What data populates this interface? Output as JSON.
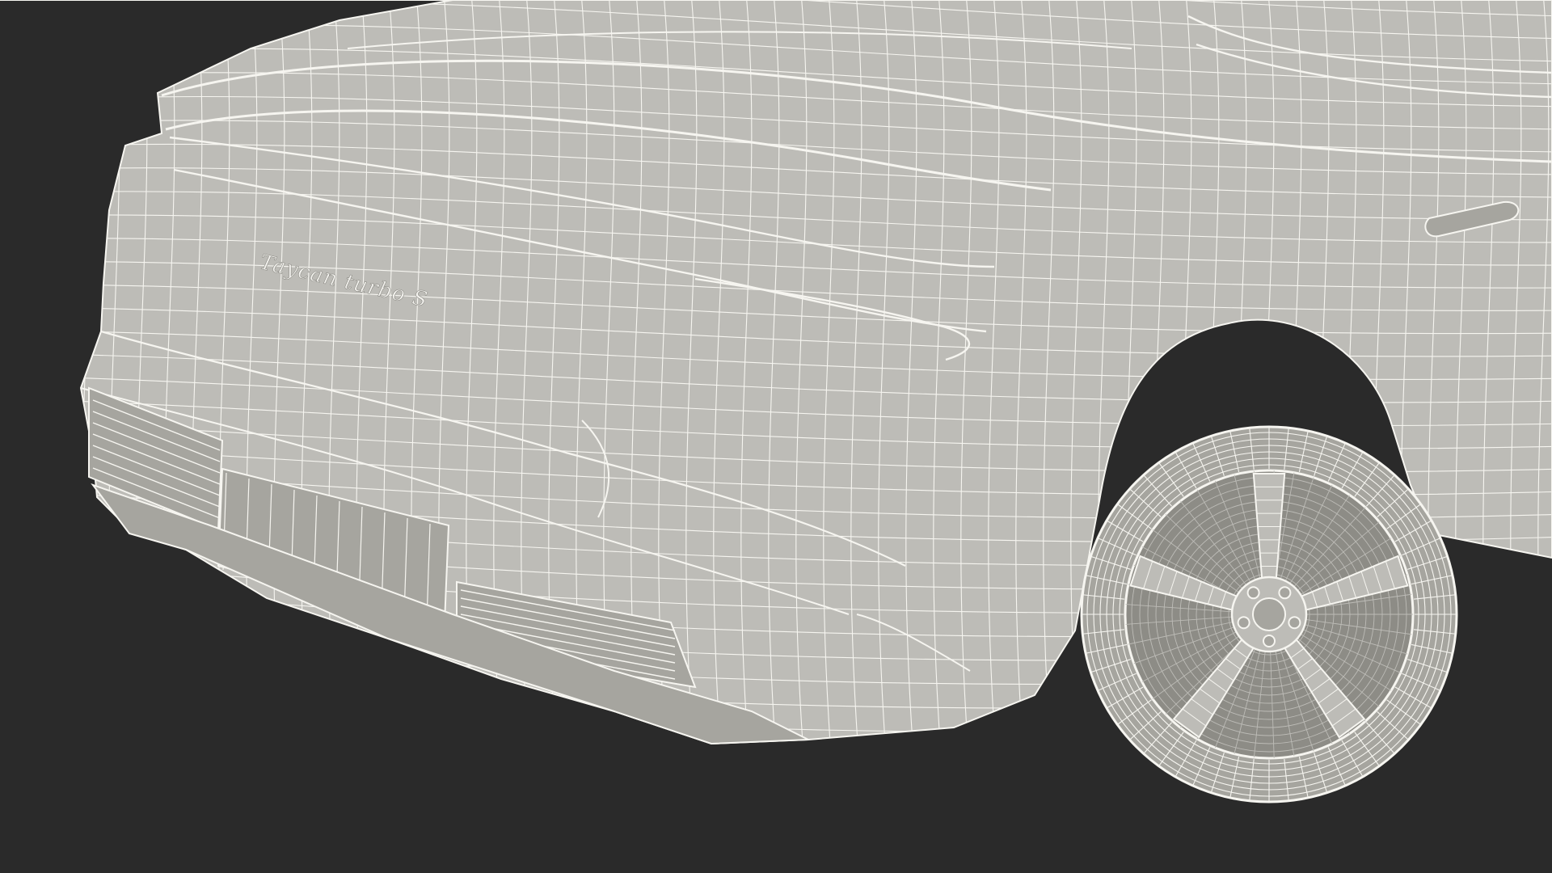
{
  "scene": {
    "subject": "car-front-wireframe",
    "background_color": "#2a2a2a",
    "surface_color": "#bdbcb7",
    "surface_shadow_color": "#a6a59f",
    "wire_color": "#f6f5f0",
    "dark_wire_color": "#8d8c86"
  },
  "badge": {
    "text": "Taycan turbo S"
  }
}
